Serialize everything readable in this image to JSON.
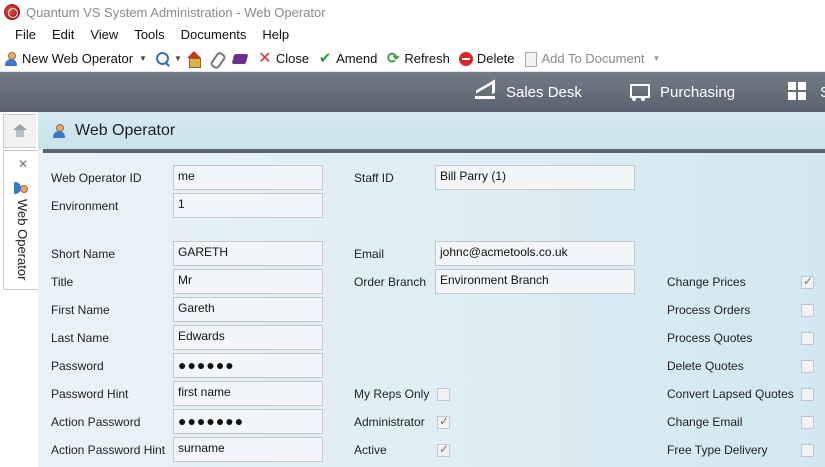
{
  "window": {
    "title": "Quantum VS System Administration -  Web Operator"
  },
  "menu": [
    "File",
    "Edit",
    "View",
    "Tools",
    "Documents",
    "Help"
  ],
  "toolbar": {
    "new_label": "New Web Operator",
    "close_label": "Close",
    "amend_label": "Amend",
    "refresh_label": "Refresh",
    "delete_label": "Delete",
    "add_to_document_label": "Add To Document"
  },
  "modules": {
    "sales_desk": "Sales Desk",
    "purchasing": "Purchasing",
    "third": "S"
  },
  "tabs": {
    "web_operator": "Web Operator"
  },
  "panel": {
    "title": "Web Operator"
  },
  "form": {
    "web_operator_id": {
      "label": "Web Operator ID",
      "value": "me"
    },
    "environment": {
      "label": "Environment",
      "value": "1"
    },
    "staff_id": {
      "label": "Staff ID",
      "value": "Bill Parry (1)"
    },
    "short_name": {
      "label": "Short Name",
      "value": "GARETH"
    },
    "title": {
      "label": "Title",
      "value": "Mr"
    },
    "first_name": {
      "label": "First Name",
      "value": "Gareth"
    },
    "last_name": {
      "label": "Last Name",
      "value": "Edwards"
    },
    "password": {
      "label": "Password",
      "value": "●●●●●●"
    },
    "password_hint": {
      "label": "Password Hint",
      "value": "first name"
    },
    "action_password": {
      "label": "Action Password",
      "value": "●●●●●●●"
    },
    "action_password_hint": {
      "label": "Action Password Hint",
      "value": "surname"
    },
    "email": {
      "label": "Email",
      "value": "johnc@acmetools.co.uk"
    },
    "order_branch": {
      "label": "Order Branch",
      "value": "Environment Branch"
    },
    "my_reps_only": {
      "label": "My Reps Only",
      "checked": false
    },
    "administrator": {
      "label": "Administrator",
      "checked": true
    },
    "active": {
      "label": "Active",
      "checked": true
    },
    "change_prices": {
      "label": "Change Prices",
      "checked": true
    },
    "process_orders": {
      "label": "Process Orders",
      "checked": false
    },
    "process_quotes": {
      "label": "Process Quotes",
      "checked": false
    },
    "delete_quotes": {
      "label": "Delete Quotes",
      "checked": false
    },
    "convert_lapsed_quotes": {
      "label": "Convert Lapsed Quotes",
      "checked": false
    },
    "change_email": {
      "label": "Change Email",
      "checked": false
    },
    "free_type_delivery": {
      "label": "Free Type Delivery",
      "checked": false
    }
  }
}
